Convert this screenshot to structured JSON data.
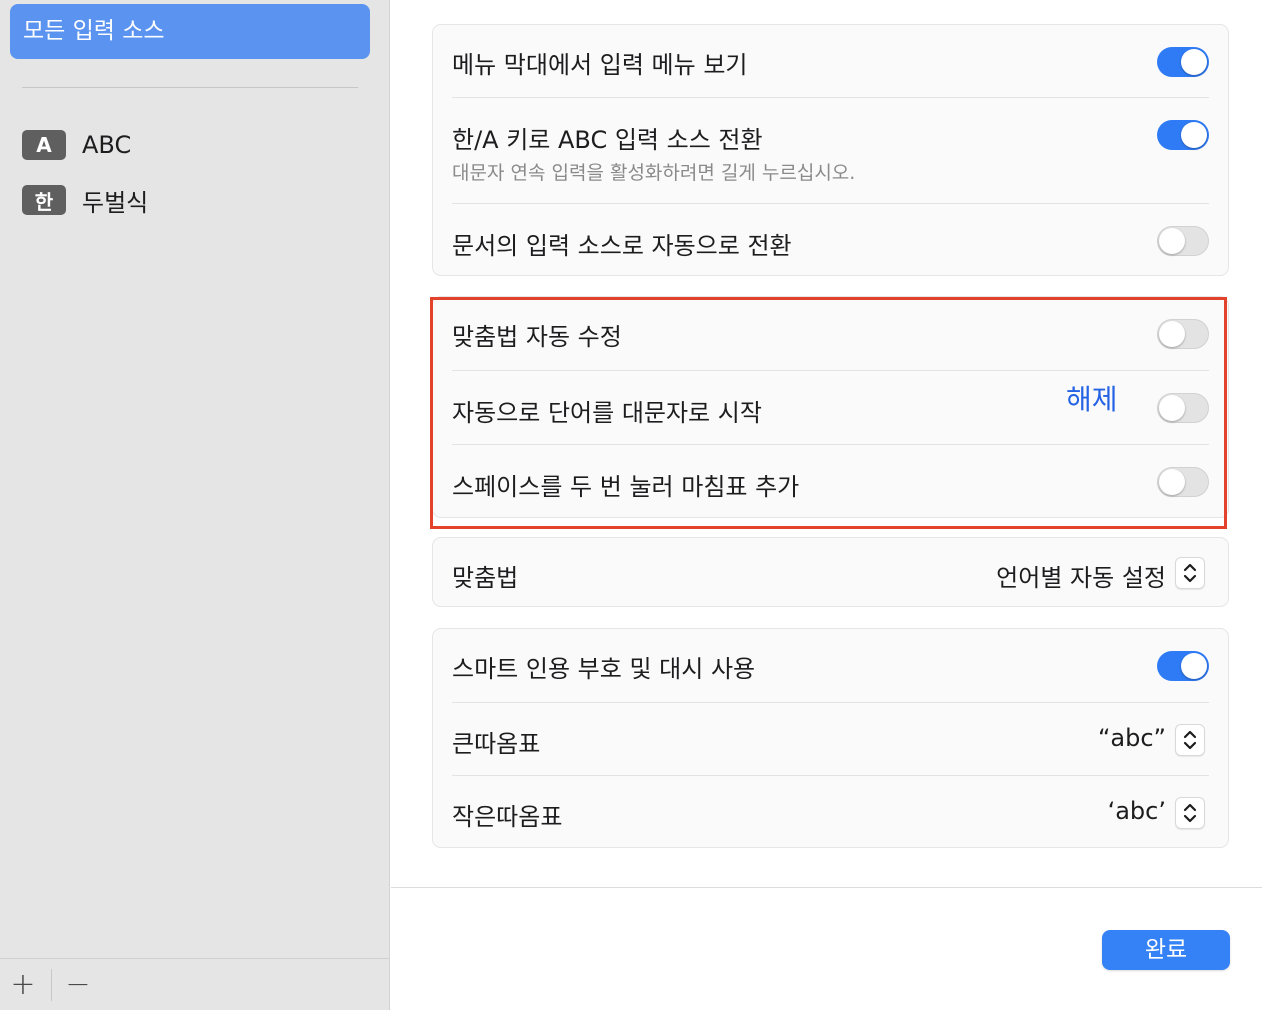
{
  "sidebar": {
    "selected_label": "모든 입력 소스",
    "sources": [
      {
        "badge": "A",
        "label": "ABC"
      },
      {
        "badge": "한",
        "label": "두벌식"
      }
    ],
    "add_label": "+",
    "remove_label": "−"
  },
  "group1": {
    "rows": [
      {
        "label": "메뉴 막대에서 입력 메뉴 보기",
        "toggle": true
      },
      {
        "label": "한/A 키로 ABC 입력 소스 전환",
        "sublabel": "대문자 연속 입력을 활성화하려면 길게 누르십시오.",
        "toggle": true
      },
      {
        "label": "문서의 입력 소스로 자동으로 전환",
        "toggle": false
      }
    ]
  },
  "group2": {
    "rows": [
      {
        "label": "맞춤법 자동 수정",
        "toggle": false
      },
      {
        "label": "자동으로 단어를 대문자로 시작",
        "toggle": false
      },
      {
        "label": "스페이스를 두 번 눌러 마침표 추가",
        "toggle": false
      }
    ]
  },
  "group3": {
    "label": "맞춤법",
    "value": "언어별 자동 설정"
  },
  "group4": {
    "rows": [
      {
        "label": "스마트 인용 부호 및 대시 사용",
        "toggle": true
      },
      {
        "label": "큰따옴표",
        "value": "“abc”"
      },
      {
        "label": "작은따옴표",
        "value": "‘abc’"
      }
    ]
  },
  "annotation": {
    "text": "해제",
    "color": "#2463e4"
  },
  "highlight_color": "#e3432b",
  "accent_color": "#2f7bf5",
  "done_label": "완료"
}
